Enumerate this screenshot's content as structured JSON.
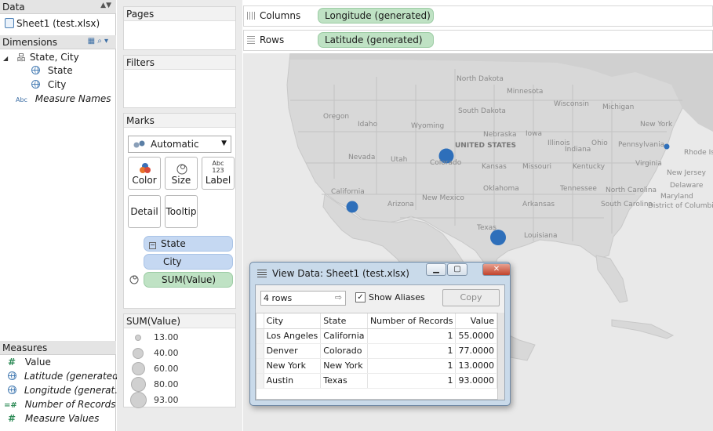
{
  "data_pane": {
    "header": "Data",
    "datasource": "Sheet1 (test.xlsx)",
    "dimensions_header": "Dimensions",
    "dimensions": [
      {
        "label": "State, City",
        "icon": "hierarchy-icon"
      },
      {
        "label": "State",
        "icon": "globe-icon"
      },
      {
        "label": "City",
        "icon": "globe-icon"
      },
      {
        "label": "Measure Names",
        "icon": "abc-icon",
        "abc": "Abc"
      }
    ],
    "measures_header": "Measures",
    "measures": [
      {
        "label": "Value",
        "icon": "hash-icon"
      },
      {
        "label": "Latitude (generated)",
        "icon": "globe-icon"
      },
      {
        "label": "Longitude (generat...",
        "icon": "globe-icon"
      },
      {
        "label": "Number of Records",
        "icon": "equals-hash-icon"
      },
      {
        "label": "Measure Values",
        "icon": "hash-icon"
      }
    ]
  },
  "pages": {
    "title": "Pages"
  },
  "filters": {
    "title": "Filters"
  },
  "marks": {
    "title": "Marks",
    "type": "Automatic",
    "buttons": {
      "color": "Color",
      "size": "Size",
      "label": "Label",
      "detail": "Detail",
      "tooltip": "Tooltip"
    },
    "label_icon_text": "Abc\n123",
    "fields": [
      {
        "label": "State",
        "kind": "dimension"
      },
      {
        "label": "City",
        "kind": "dimension"
      },
      {
        "label": "SUM(Value)",
        "kind": "measure"
      }
    ]
  },
  "size_legend": {
    "title": "SUM(Value)",
    "items": [
      "13.00",
      "40.00",
      "60.00",
      "80.00",
      "93.00"
    ]
  },
  "shelves": {
    "columns_label": "Columns",
    "columns_pill": "Longitude (generated)",
    "rows_label": "Rows",
    "rows_pill": "Latitude (generated)"
  },
  "map": {
    "colors": {
      "point": "#2e6fba",
      "land": "#d8d8d8",
      "water": "#e9e9e9"
    },
    "points": [
      {
        "city": "Los Angeles",
        "value": 55.0
      },
      {
        "city": "Denver",
        "value": 77.0
      },
      {
        "city": "New York",
        "value": 13.0
      },
      {
        "city": "Austin",
        "value": 93.0
      }
    ],
    "labels": [
      "North Dakota",
      "Minnesota",
      "Wisconsin",
      "Michigan",
      "New York",
      "Oregon",
      "Idaho",
      "South Dakota",
      "Wyoming",
      "Iowa",
      "Nebraska",
      "UNITED STATES",
      "Illinois",
      "Indiana",
      "Ohio",
      "Pennsylvania",
      "Rhode Isl",
      "Nevada",
      "Utah",
      "Colorado",
      "Kansas",
      "Missouri",
      "Kentucky",
      "Virginia",
      "New Jersey",
      "California",
      "Oklahoma",
      "Tennessee",
      "North Carolina",
      "Delaware",
      "Arizona",
      "New Mexico",
      "Arkansas",
      "South Carolina",
      "Maryland",
      "District of Columbia",
      "Texas",
      "Louisiana"
    ]
  },
  "dialog": {
    "title": "View Data:  Sheet1 (test.xlsx)",
    "rows_count": "4 rows",
    "show_aliases": "Show Aliases",
    "show_aliases_checked": true,
    "copy": "Copy",
    "columns": [
      "City",
      "State",
      "Number of Records",
      "Value"
    ],
    "rows": [
      [
        "Los Angeles",
        "California",
        "1",
        "55.0000"
      ],
      [
        "Denver",
        "Colorado",
        "1",
        "77.0000"
      ],
      [
        "New York",
        "New York",
        "1",
        "13.0000"
      ],
      [
        "Austin",
        "Texas",
        "1",
        "93.0000"
      ]
    ]
  }
}
